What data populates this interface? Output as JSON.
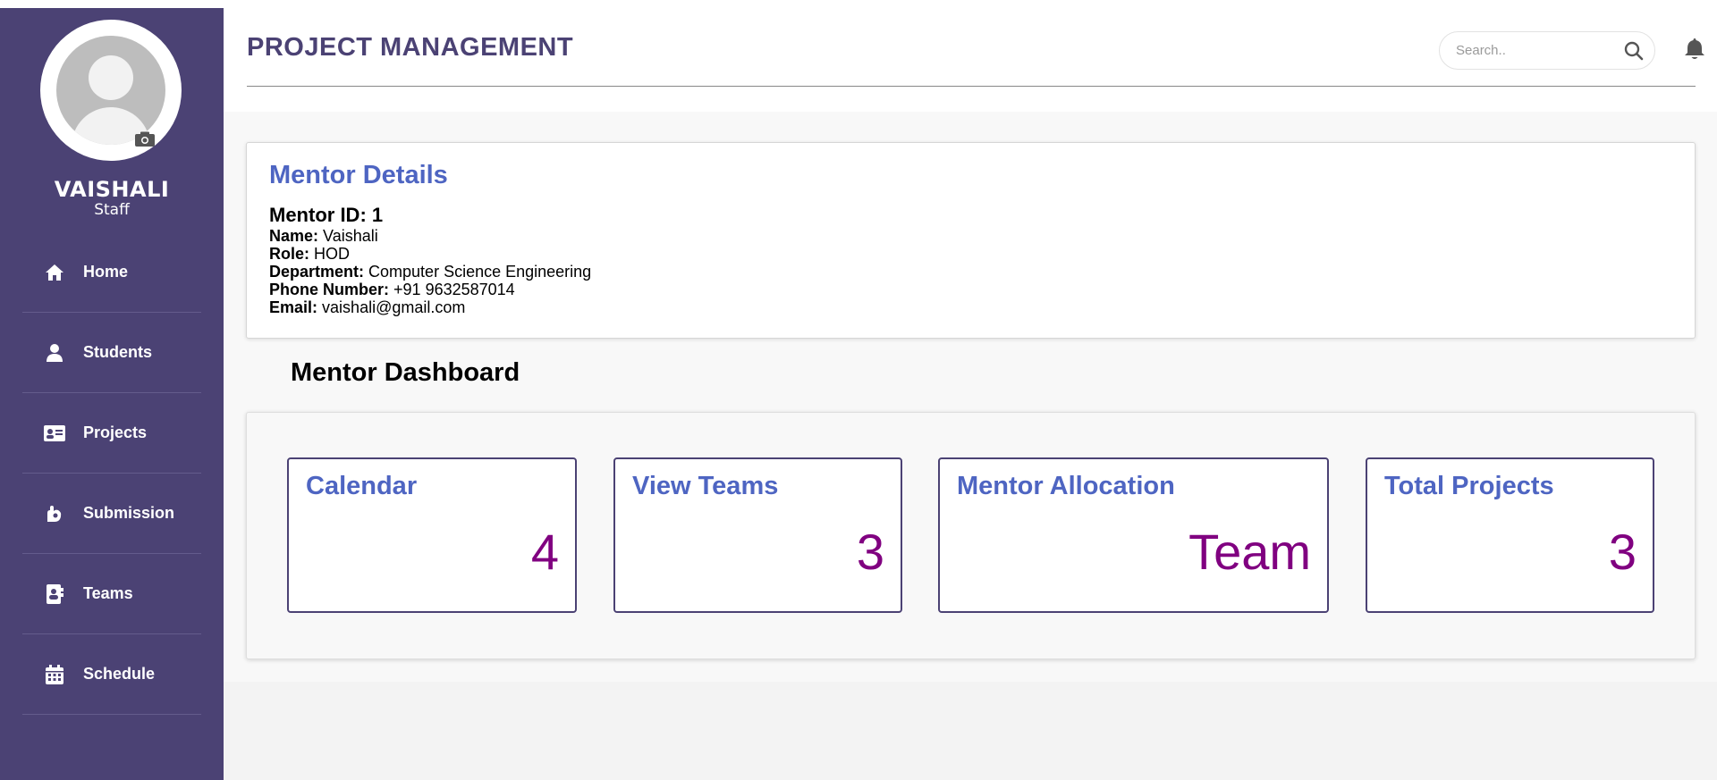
{
  "app": {
    "title": "PROJECT MANAGEMENT"
  },
  "search": {
    "placeholder": "Search..",
    "value": ""
  },
  "user": {
    "name": "VAISHALI",
    "role": "Staff"
  },
  "sidebar": {
    "items": [
      {
        "label": "Home",
        "icon": "home-icon"
      },
      {
        "label": "Students",
        "icon": "user-icon"
      },
      {
        "label": "Projects",
        "icon": "id-card-icon"
      },
      {
        "label": "Submission",
        "icon": "hand-paper-icon"
      },
      {
        "label": "Teams",
        "icon": "address-book-icon"
      },
      {
        "label": "Schedule",
        "icon": "calendar-icon"
      }
    ]
  },
  "mentor": {
    "heading": "Mentor Details",
    "id_label": "Mentor ID: 1",
    "fields": [
      {
        "label": "Name:",
        "value": "Vaishali"
      },
      {
        "label": "Role:",
        "value": "HOD"
      },
      {
        "label": "Department:",
        "value": "Computer Science Engineering"
      },
      {
        "label": "Phone Number:",
        "value": "+91 9632587014"
      },
      {
        "label": "Email:",
        "value": "vaishali@gmail.com"
      }
    ]
  },
  "dashboard": {
    "title": "Mentor Dashboard",
    "tiles": [
      {
        "title": "Calendar",
        "value": "4"
      },
      {
        "title": "View Teams",
        "value": "3"
      },
      {
        "title": "Mentor Allocation",
        "value": "Team"
      },
      {
        "title": "Total Projects",
        "value": "3"
      }
    ]
  },
  "colors": {
    "sidebar_bg": "#4b4274",
    "heading_blue": "#4e65c2",
    "value_purple": "#800080",
    "title_purple": "#4b4274"
  }
}
